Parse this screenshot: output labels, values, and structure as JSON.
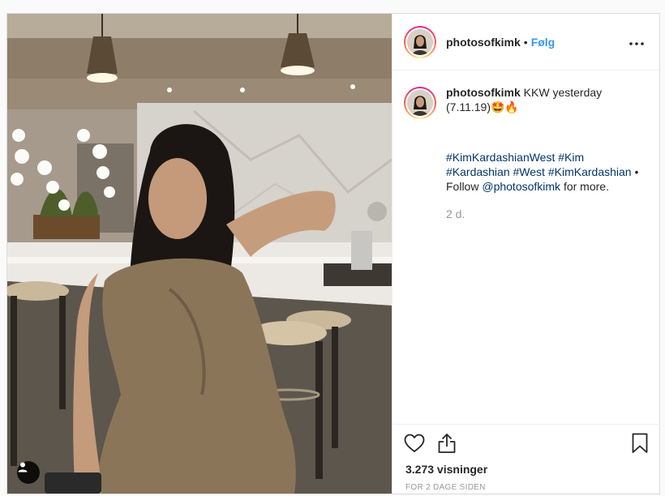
{
  "post": {
    "username": "photosofkimk",
    "separator": "•",
    "follow_label": "Følg",
    "more_icon": "more-horizontal-icon",
    "caption": {
      "username": "photosofkimk",
      "text": " KKW yesterday\n(7.11.19)🤩🔥",
      "hashtags": [
        "#KimKardashianWest",
        "#Kim",
        "#Kardashian",
        "#West",
        "#KimKardashian"
      ],
      "follow_prefix": " • Follow ",
      "mention": "@photosofkimk",
      "follow_suffix": " for more.",
      "time": "2 d."
    },
    "views": "3.273 visninger",
    "age": "FOR 2 DAGE SIDEN",
    "icons": {
      "like": "heart-icon",
      "share": "share-icon",
      "save": "bookmark-icon",
      "tag": "user-tag-icon"
    },
    "colors": {
      "link": "#3897f0",
      "hashtag": "#003569",
      "muted": "#999999",
      "border": "#dbdbdb"
    }
  }
}
